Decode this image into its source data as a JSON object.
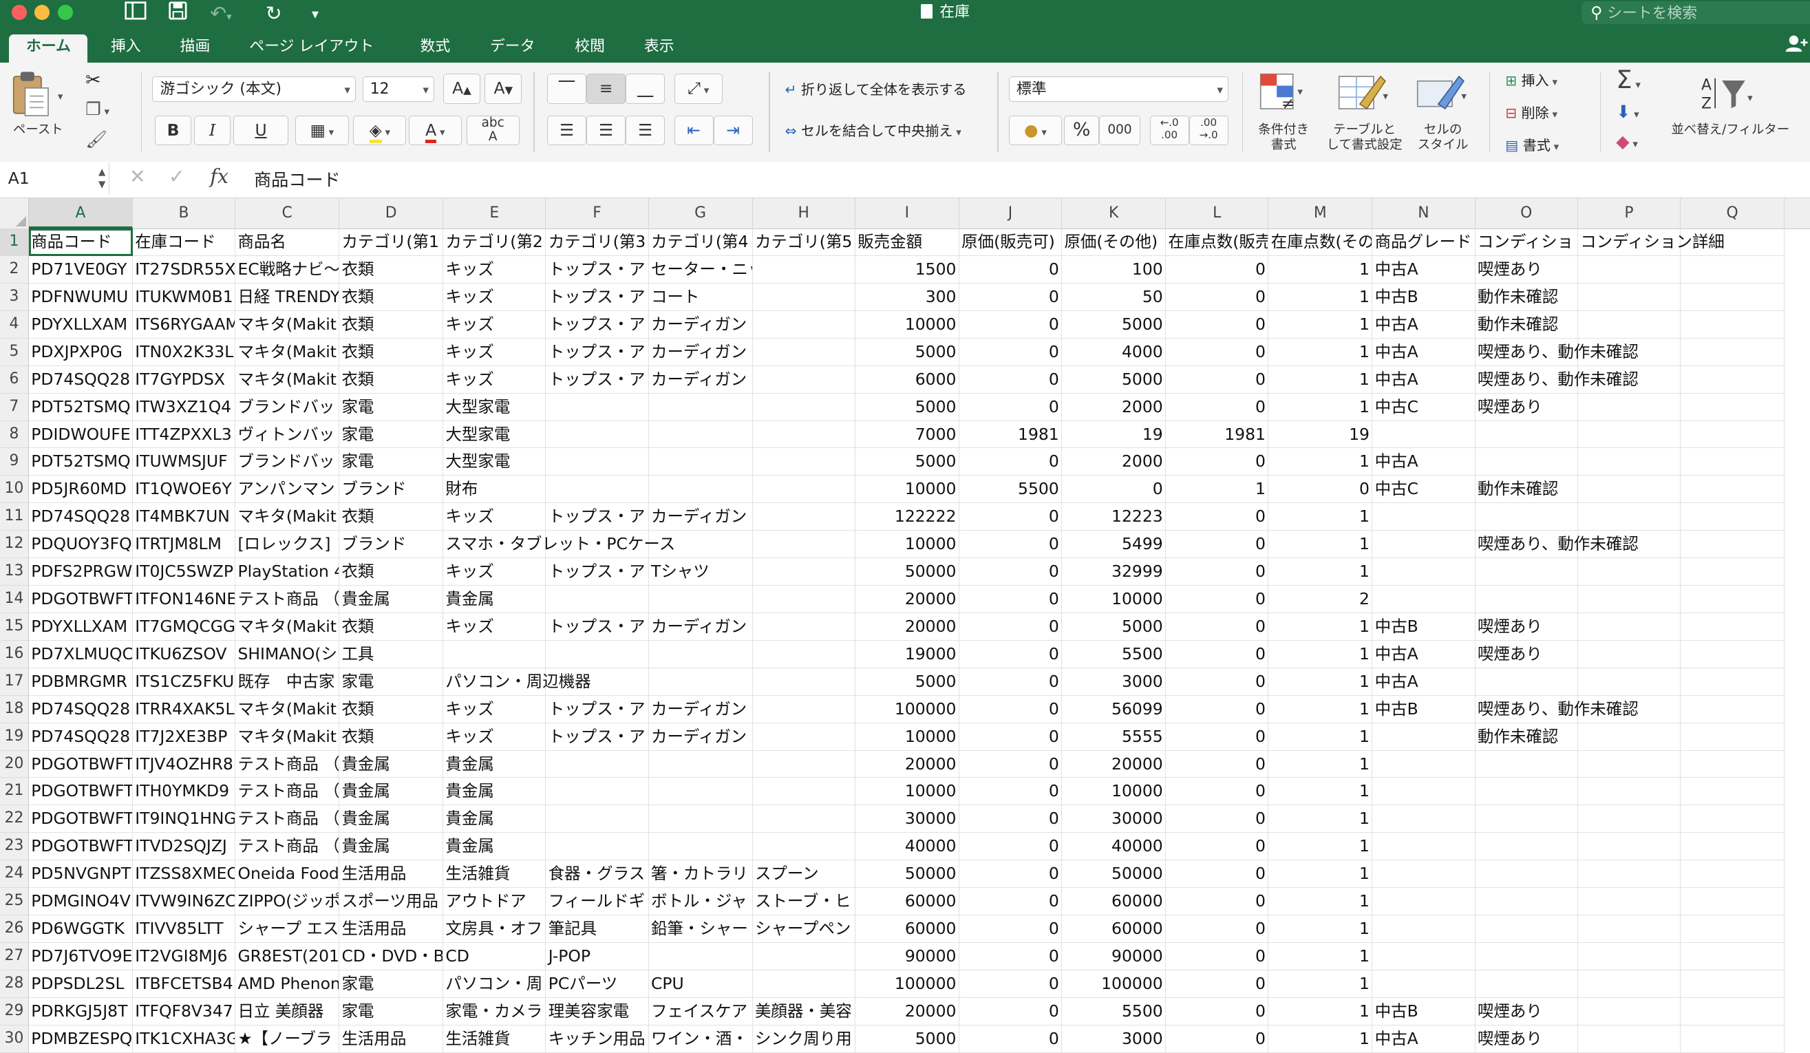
{
  "window": {
    "title": "在庫",
    "search_placeholder": "シートを検索"
  },
  "ribbon": {
    "tabs": [
      "ホーム",
      "挿入",
      "描画",
      "ページ レイアウト",
      "数式",
      "データ",
      "校閲",
      "表示"
    ],
    "active_tab": "ホーム",
    "paste_label": "ペースト",
    "font_name": "游ゴシック (本文)",
    "font_size": "12",
    "wrap_text": "折り返して全体を表示する",
    "merge_center": "セルを結合して中央揃え",
    "number_format": "標準",
    "conditional_format": [
      "条件付き",
      "書式"
    ],
    "table_format": [
      "テーブルと",
      "して書式設定"
    ],
    "cell_style": [
      "セルの",
      "スタイル"
    ],
    "insert_label": "挿入",
    "delete_label": "削除",
    "format_label": "書式",
    "sort_filter": "並べ替え/フィルター",
    "bold": "B",
    "italic": "I",
    "underline": "U",
    "percent": "%",
    "thousands": "000"
  },
  "formula_bar": {
    "name_box": "A1",
    "fx": "fx",
    "content": "商品コード"
  },
  "columns": [
    "A",
    "B",
    "C",
    "D",
    "E",
    "F",
    "G",
    "H",
    "I",
    "J",
    "K",
    "L",
    "M",
    "N",
    "O",
    "P",
    "Q"
  ],
  "selected_column": "A",
  "rows": [
    [
      "1",
      "商品コード",
      "在庫コード",
      "商品名",
      "カテゴリ(第1",
      "カテゴリ(第2",
      "カテゴリ(第3",
      "カテゴリ(第4",
      "カテゴリ(第5",
      "販売金額",
      "原価(販売可)",
      "原価(その他)",
      "在庫点数(販売",
      "在庫点数(その",
      "商品グレード",
      "コンディショ",
      "コンディション詳細",
      ""
    ],
    [
      "2",
      "PD71VE0GY",
      "IT27SDR55X",
      "EC戦略ナビ～",
      "衣類",
      "キッズ",
      "トップス・ア",
      "セーター・ニット",
      "",
      "1500",
      "0",
      "100",
      "0",
      "1",
      "中古A",
      "喫煙あり",
      "",
      ""
    ],
    [
      "3",
      "PDFNWUMU",
      "ITUKWM0B1",
      "日経 TRENDY",
      "衣類",
      "キッズ",
      "トップス・ア",
      "コート",
      "",
      "300",
      "0",
      "50",
      "0",
      "1",
      "中古B",
      "動作未確認",
      "",
      ""
    ],
    [
      "4",
      "PDYXLLXAM",
      "ITS6RYGAAM",
      "マキタ(Makit",
      "衣類",
      "キッズ",
      "トップス・ア",
      "カーディガン",
      "",
      "10000",
      "0",
      "5000",
      "0",
      "1",
      "中古A",
      "動作未確認",
      "",
      ""
    ],
    [
      "5",
      "PDXJPXP0G",
      "ITN0X2K33L",
      "マキタ(Makit",
      "衣類",
      "キッズ",
      "トップス・ア",
      "カーディガン",
      "",
      "5000",
      "0",
      "4000",
      "0",
      "1",
      "中古A",
      "喫煙あり、動作未確認",
      "",
      ""
    ],
    [
      "6",
      "PD74SQQ28",
      "IT7GYPDSX",
      "マキタ(Makit",
      "衣類",
      "キッズ",
      "トップス・ア",
      "カーディガン",
      "",
      "6000",
      "0",
      "5000",
      "0",
      "1",
      "中古A",
      "喫煙あり、動作未確認",
      "",
      ""
    ],
    [
      "7",
      "PDT52TSMQ",
      "ITW3XZ1Q4",
      "ブランドバッ",
      "家電",
      "大型家電",
      "",
      "",
      "",
      "5000",
      "0",
      "2000",
      "0",
      "1",
      "中古C",
      "喫煙あり",
      "",
      ""
    ],
    [
      "8",
      "PDIDWOUFE",
      "ITT4ZPXXL3",
      "ヴィトンバッ",
      "家電",
      "大型家電",
      "",
      "",
      "",
      "7000",
      "1981",
      "19",
      "1981",
      "19",
      "",
      "",
      "",
      ""
    ],
    [
      "9",
      "PDT52TSMQ",
      "ITUWMSJUF",
      "ブランドバッ",
      "家電",
      "大型家電",
      "",
      "",
      "",
      "5000",
      "0",
      "2000",
      "0",
      "1",
      "中古A",
      "",
      "",
      ""
    ],
    [
      "10",
      "PD5JR60MD",
      "IT1QWOE6Y",
      "アンパンマン",
      "ブランド",
      "財布",
      "",
      "",
      "",
      "10000",
      "5500",
      "0",
      "1",
      "0",
      "中古C",
      "動作未確認",
      "",
      ""
    ],
    [
      "11",
      "PD74SQQ28",
      "IT4MBK7UN",
      "マキタ(Makit",
      "衣類",
      "キッズ",
      "トップス・ア",
      "カーディガン",
      "",
      "122222",
      "0",
      "12223",
      "0",
      "1",
      "",
      "",
      "",
      ""
    ],
    [
      "12",
      "PDQUOY3FQ",
      "ITRTJM8LM",
      "[ロレックス]",
      "ブランド",
      "スマホ・タブレット・PCケース",
      "",
      "",
      "",
      "10000",
      "0",
      "5499",
      "0",
      "1",
      "",
      "喫煙あり、動作未確認",
      "",
      ""
    ],
    [
      "13",
      "PDFS2PRGW",
      "IT0JC5SWZP",
      "PlayStation 4",
      "衣類",
      "キッズ",
      "トップス・ア",
      "Tシャツ",
      "",
      "50000",
      "0",
      "32999",
      "0",
      "1",
      "",
      "",
      "",
      ""
    ],
    [
      "14",
      "PDGOTBWFT",
      "ITFON146NE",
      "テスト商品 （",
      "貴金属",
      "貴金属",
      "",
      "",
      "",
      "20000",
      "0",
      "10000",
      "0",
      "2",
      "",
      "",
      "",
      ""
    ],
    [
      "15",
      "PDYXLLXAM",
      "IT7GMQCGG",
      "マキタ(Makit",
      "衣類",
      "キッズ",
      "トップス・ア",
      "カーディガン",
      "",
      "20000",
      "0",
      "5000",
      "0",
      "1",
      "中古B",
      "喫煙あり",
      "",
      ""
    ],
    [
      "16",
      "PD7XLMUQC",
      "ITKU6ZSOV",
      "SHIMANO(シ",
      "工具",
      "",
      "",
      "",
      "",
      "19000",
      "0",
      "5500",
      "0",
      "1",
      "中古A",
      "喫煙あり",
      "",
      ""
    ],
    [
      "17",
      "PDBMRGMR",
      "ITS1CZ5FKU",
      "既存　中古家",
      "家電",
      "パソコン・周辺機器",
      "",
      "",
      "",
      "5000",
      "0",
      "3000",
      "0",
      "1",
      "中古A",
      "",
      "",
      ""
    ],
    [
      "18",
      "PD74SQQ28",
      "ITRR4XAK5L",
      "マキタ(Makit",
      "衣類",
      "キッズ",
      "トップス・ア",
      "カーディガン",
      "",
      "100000",
      "0",
      "56099",
      "0",
      "1",
      "中古B",
      "喫煙あり、動作未確認",
      "",
      ""
    ],
    [
      "19",
      "PD74SQQ28",
      "IT7J2XE3BP",
      "マキタ(Makit",
      "衣類",
      "キッズ",
      "トップス・ア",
      "カーディガン",
      "",
      "10000",
      "0",
      "5555",
      "0",
      "1",
      "",
      "動作未確認",
      "",
      ""
    ],
    [
      "20",
      "PDGOTBWFT",
      "ITJV4OZHR8",
      "テスト商品 （",
      "貴金属",
      "貴金属",
      "",
      "",
      "",
      "20000",
      "0",
      "20000",
      "0",
      "1",
      "",
      "",
      "",
      ""
    ],
    [
      "21",
      "PDGOTBWFT",
      "ITH0YMKD9",
      "テスト商品 （",
      "貴金属",
      "貴金属",
      "",
      "",
      "",
      "10000",
      "0",
      "10000",
      "0",
      "1",
      "",
      "",
      "",
      ""
    ],
    [
      "22",
      "PDGOTBWFT",
      "IT9INQ1HNG",
      "テスト商品 （",
      "貴金属",
      "貴金属",
      "",
      "",
      "",
      "30000",
      "0",
      "30000",
      "0",
      "1",
      "",
      "",
      "",
      ""
    ],
    [
      "23",
      "PDGOTBWFT",
      "ITVD2SQJZJ",
      "テスト商品 （",
      "貴金属",
      "貴金属",
      "",
      "",
      "",
      "40000",
      "0",
      "40000",
      "0",
      "1",
      "",
      "",
      "",
      ""
    ],
    [
      "24",
      "PD5NVGNPT",
      "ITZSS8XMEC",
      "Oneida Food",
      "生活用品",
      "生活雑貨",
      "食器・グラス",
      "箸・カトラリ",
      "スプーン",
      "50000",
      "0",
      "50000",
      "0",
      "1",
      "",
      "",
      "",
      ""
    ],
    [
      "25",
      "PDMGINO4V",
      "ITVW9IN6ZC",
      "ZIPPO(ジッポ",
      "スポーツ用品",
      "アウトドア",
      "フィールドギ",
      "ボトル・ジャ",
      "ストーブ・ヒ",
      "60000",
      "0",
      "60000",
      "0",
      "1",
      "",
      "",
      "",
      ""
    ],
    [
      "26",
      "PD6WGGTK",
      "ITIVV85LTT",
      "シャープ エス",
      "生活用品",
      "文房具・オフ",
      "筆記具",
      "鉛筆・シャー",
      "シャープペン",
      "60000",
      "0",
      "60000",
      "0",
      "1",
      "",
      "",
      "",
      ""
    ],
    [
      "27",
      "PD7J6TVO9E",
      "IT2VGI8MJ6",
      "GR8EST(201",
      "CD・DVD・B",
      "CD",
      "J-POP",
      "",
      "",
      "90000",
      "0",
      "90000",
      "0",
      "1",
      "",
      "",
      "",
      ""
    ],
    [
      "28",
      "PDPSDL2SL",
      "ITBFCETSB4",
      "AMD Phenon",
      "家電",
      "パソコン・周",
      "PCパーツ",
      "CPU",
      "",
      "100000",
      "0",
      "100000",
      "0",
      "1",
      "",
      "",
      "",
      ""
    ],
    [
      "29",
      "PDRKGJ5J8T",
      "ITFQF8V347",
      "日立 美顔器",
      "家電",
      "家電・カメラ",
      "理美容家電",
      "フェイスケア",
      "美顔器・美容",
      "20000",
      "0",
      "5500",
      "0",
      "1",
      "中古B",
      "喫煙あり",
      "",
      ""
    ],
    [
      "30",
      "PDMBZESPQ",
      "ITK1CXHA3G",
      "★【ノーブラ",
      "生活用品",
      "生活雑貨",
      "キッチン用品",
      "ワイン・酒・",
      "シンク周り用",
      "5000",
      "0",
      "3000",
      "0",
      "1",
      "中古A",
      "喫煙あり",
      "",
      ""
    ]
  ]
}
